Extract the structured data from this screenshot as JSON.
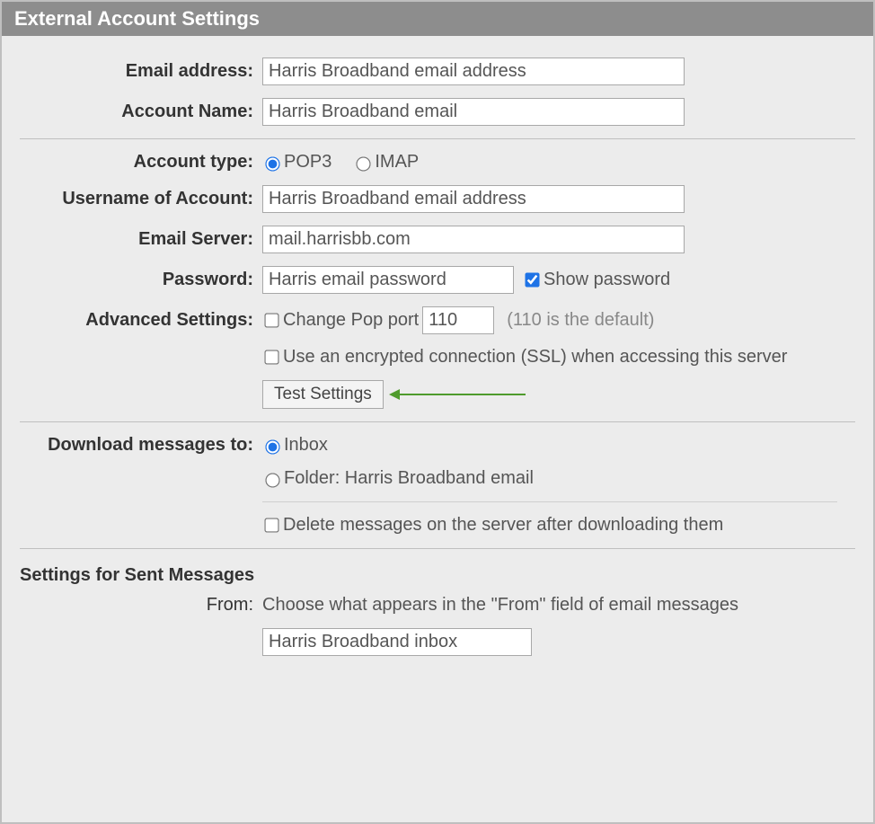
{
  "titlebar": {
    "title": "External Account Settings"
  },
  "fields": {
    "email_address": {
      "label": "Email address:",
      "value": "Harris Broadband email address"
    },
    "account_name": {
      "label": "Account Name:",
      "value": "Harris Broadband email"
    },
    "account_type": {
      "label": "Account type:",
      "pop3_label": "POP3",
      "imap_label": "IMAP",
      "selected": "pop3"
    },
    "username": {
      "label": "Username of Account:",
      "value": "Harris Broadband email address"
    },
    "email_server": {
      "label": "Email Server:",
      "value": "mail.harrisbb.com"
    },
    "password": {
      "label": "Password:",
      "value": "Harris email password",
      "show_password_label": "Show password",
      "show_password_checked": true
    },
    "advanced": {
      "label": "Advanced Settings:",
      "change_port_label": "Change Pop port",
      "port_value": "110",
      "port_hint": "(110 is the default)",
      "ssl_label": "Use an encrypted connection (SSL) when accessing this server",
      "test_button": "Test Settings"
    },
    "download": {
      "label": "Download messages to:",
      "inbox_label": "Inbox",
      "folder_label": "Folder: Harris Broadband email",
      "selected": "inbox",
      "delete_label": "Delete messages on the server after downloading them"
    },
    "sent": {
      "heading": "Settings for Sent Messages",
      "from_label": "From:",
      "from_text": "Choose what appears in the \"From\" field of email messages",
      "from_value": "Harris Broadband inbox"
    }
  }
}
